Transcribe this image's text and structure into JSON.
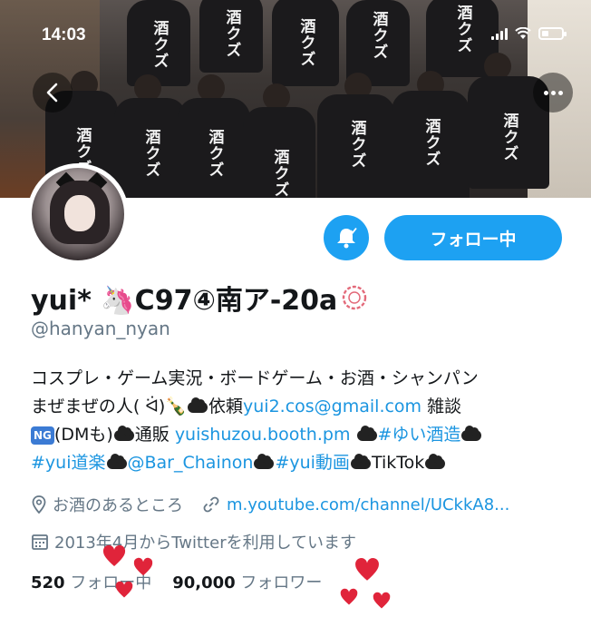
{
  "status_bar": {
    "time": "14:03"
  },
  "header": {
    "banner_alt": "group photo banner"
  },
  "banner_kanji": [
    "酒クズ",
    "酒クズ",
    "酒クズ",
    "酒クズ",
    "酒クズ",
    "酒クズ",
    "酒クズ",
    "酒クズ",
    "酒クズ",
    "酒クズ",
    "酒クズ",
    "酒クズ"
  ],
  "actions": {
    "follow_label": "フォロー中"
  },
  "profile": {
    "display_name": "yui* 🦄C97④南ア-20a",
    "handle": "@hanyan_nyan",
    "bio_line1": "コスプレ・ゲーム実況・ボードゲーム・お酒・シャンパン",
    "bio_line2_a": "まぜまぜの人( ᐛ)🍾",
    "bio_line2_b": "依頼",
    "bio_email": "yui2.cos@gmail.com",
    "bio_line2_c": " 雑談",
    "ng_badge": "NG",
    "bio_line3_a": "(DMも)",
    "bio_line3_b": "通販 ",
    "bio_booth": "yuishuzou.booth.pm",
    "bio_tag1": "#ゆい酒造",
    "bio_tag2": "#yui道楽",
    "bio_mention": "@Bar_Chainon",
    "bio_tag3": "#yui動画",
    "bio_tiktok": "TikTok",
    "location": "お酒のあるところ",
    "website": "m.youtube.com/channel/UCkkA8...",
    "joined": "2013年4月からTwitterを利用しています",
    "following_count": "520",
    "following_label": "フォロー中",
    "followers_count": "90,000",
    "followers_label": "フォロワー"
  },
  "colors": {
    "accent": "#1da1f2",
    "link": "#1b95e0",
    "secondary_text": "#657786",
    "heart": "#e0243a"
  },
  "icons": [
    "back-chevron-icon",
    "more-icon",
    "bell-icon",
    "location-icon",
    "link-icon",
    "calendar-icon",
    "unicorn-icon",
    "champagne-icon"
  ]
}
